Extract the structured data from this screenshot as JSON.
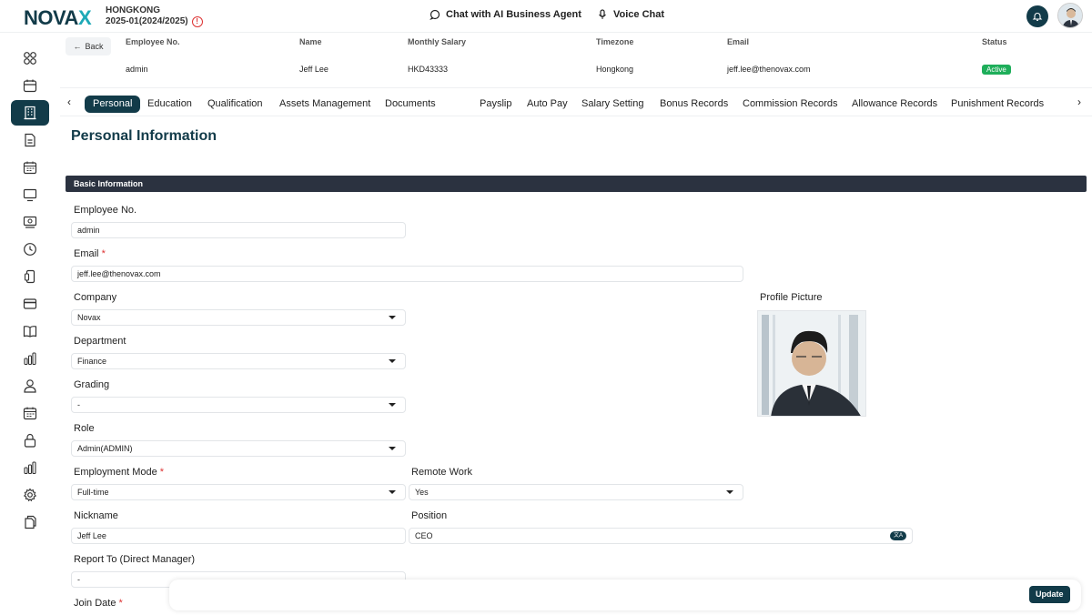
{
  "header": {
    "logo_main": "NOVA",
    "logo_accent": "X",
    "region": "HONGKONG",
    "period": "2025-01(2024/2025)",
    "chat_label": "Chat with AI Business Agent",
    "voice_label": "Voice Chat"
  },
  "sidebar": {
    "items": [
      {
        "icon": "dashboard-icon"
      },
      {
        "icon": "calendar-icon"
      },
      {
        "icon": "building-icon",
        "active": true
      },
      {
        "icon": "document-icon"
      },
      {
        "icon": "schedule-icon"
      },
      {
        "icon": "monitor-icon"
      },
      {
        "icon": "payroll-icon"
      },
      {
        "icon": "clock-icon"
      },
      {
        "icon": "device-icon"
      },
      {
        "icon": "card-icon"
      },
      {
        "icon": "book-icon"
      },
      {
        "icon": "chart-icon"
      },
      {
        "icon": "user-icon"
      },
      {
        "icon": "calendar-grid-icon"
      },
      {
        "icon": "lock-icon"
      },
      {
        "icon": "bar-chart-icon"
      },
      {
        "icon": "settings-icon"
      },
      {
        "icon": "copy-icon"
      }
    ]
  },
  "employee": {
    "back_label": "Back",
    "headers": [
      "Employee No.",
      "Name",
      "Monthly Salary",
      "Timezone",
      "Email",
      "Status"
    ],
    "values": [
      "admin",
      "Jeff Lee",
      "HKD43333",
      "Hongkong",
      "jeff.lee@thenovax.com"
    ],
    "status": "Active"
  },
  "tabs": [
    "Personal",
    "Education",
    "Qualification",
    "Assets Management",
    "Documents",
    "Payslip",
    "Auto Pay",
    "Salary Setting",
    "Bonus Records",
    "Commission Records",
    "Allowance Records",
    "Punishment Records"
  ],
  "page": {
    "title": "Personal Information",
    "section": "Basic Information"
  },
  "form": {
    "employee_no_label": "Employee No.",
    "employee_no": "admin",
    "email_label": "Email",
    "email": "jeff.lee@thenovax.com",
    "company_label": "Company",
    "company": "Novax",
    "profile_picture_label": "Profile Picture",
    "department_label": "Department",
    "department": "Finance",
    "grading_label": "Grading",
    "grading": "-",
    "role_label": "Role",
    "role": "Admin(ADMIN)",
    "employment_mode_label": "Employment Mode",
    "employment_mode": "Full-time",
    "remote_work_label": "Remote Work",
    "remote_work": "Yes",
    "nickname_label": "Nickname",
    "nickname": "Jeff Lee",
    "position_label": "Position",
    "position": "CEO",
    "report_to_label": "Report To (Direct Manager)",
    "report_to": "-",
    "join_date_label": "Join Date",
    "required_mark": "*"
  },
  "footer": {
    "update_label": "Update"
  },
  "colors": {
    "brand": "#123b49",
    "accent": "#1ea9b7",
    "active": "#1eae5a",
    "required": "#d33333"
  }
}
